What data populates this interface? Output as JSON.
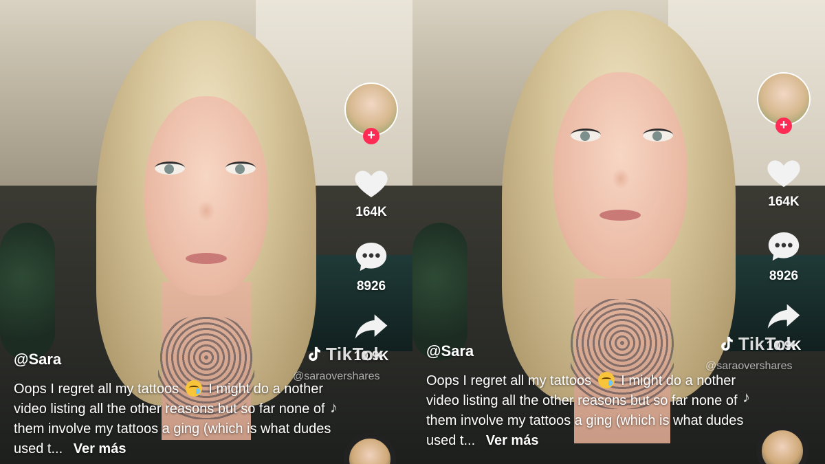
{
  "frames": [
    {
      "username": "@Sara",
      "caption": {
        "part1": "Oops I regret all my tattoos",
        "emoji": "face-holding-back-tears",
        "part2": " I might do a nother video listing all the other reasons but so far none of them involve my tattoos a ging (which is what dudes used t...",
        "more": "Ver más"
      },
      "likes": "164K",
      "comments": "8926",
      "shares": "10.9K",
      "watermark": {
        "brand": "TikTok",
        "handle": "@saraovershares"
      }
    },
    {
      "username": "@Sara",
      "caption": {
        "part1": "Oops I regret all my tattoos",
        "emoji": "face-holding-back-tears",
        "part2": " I might do a nother video listing all the other reasons but so far none of them involve my tattoos a ging (which is what dudes used t...",
        "more": "Ver más"
      },
      "likes": "164K",
      "comments": "8926",
      "shares": "10.9K",
      "watermark": {
        "brand": "TikTok",
        "handle": "@saraovershares"
      }
    }
  ],
  "icons": {
    "like": "heart-icon",
    "comment": "comment-bubble-icon",
    "share": "share-arrow-icon",
    "follow": "plus-icon",
    "music": "music-note-icon"
  },
  "colors": {
    "follow_accent": "#fe2c55",
    "overlay_text": "#ffffff"
  }
}
